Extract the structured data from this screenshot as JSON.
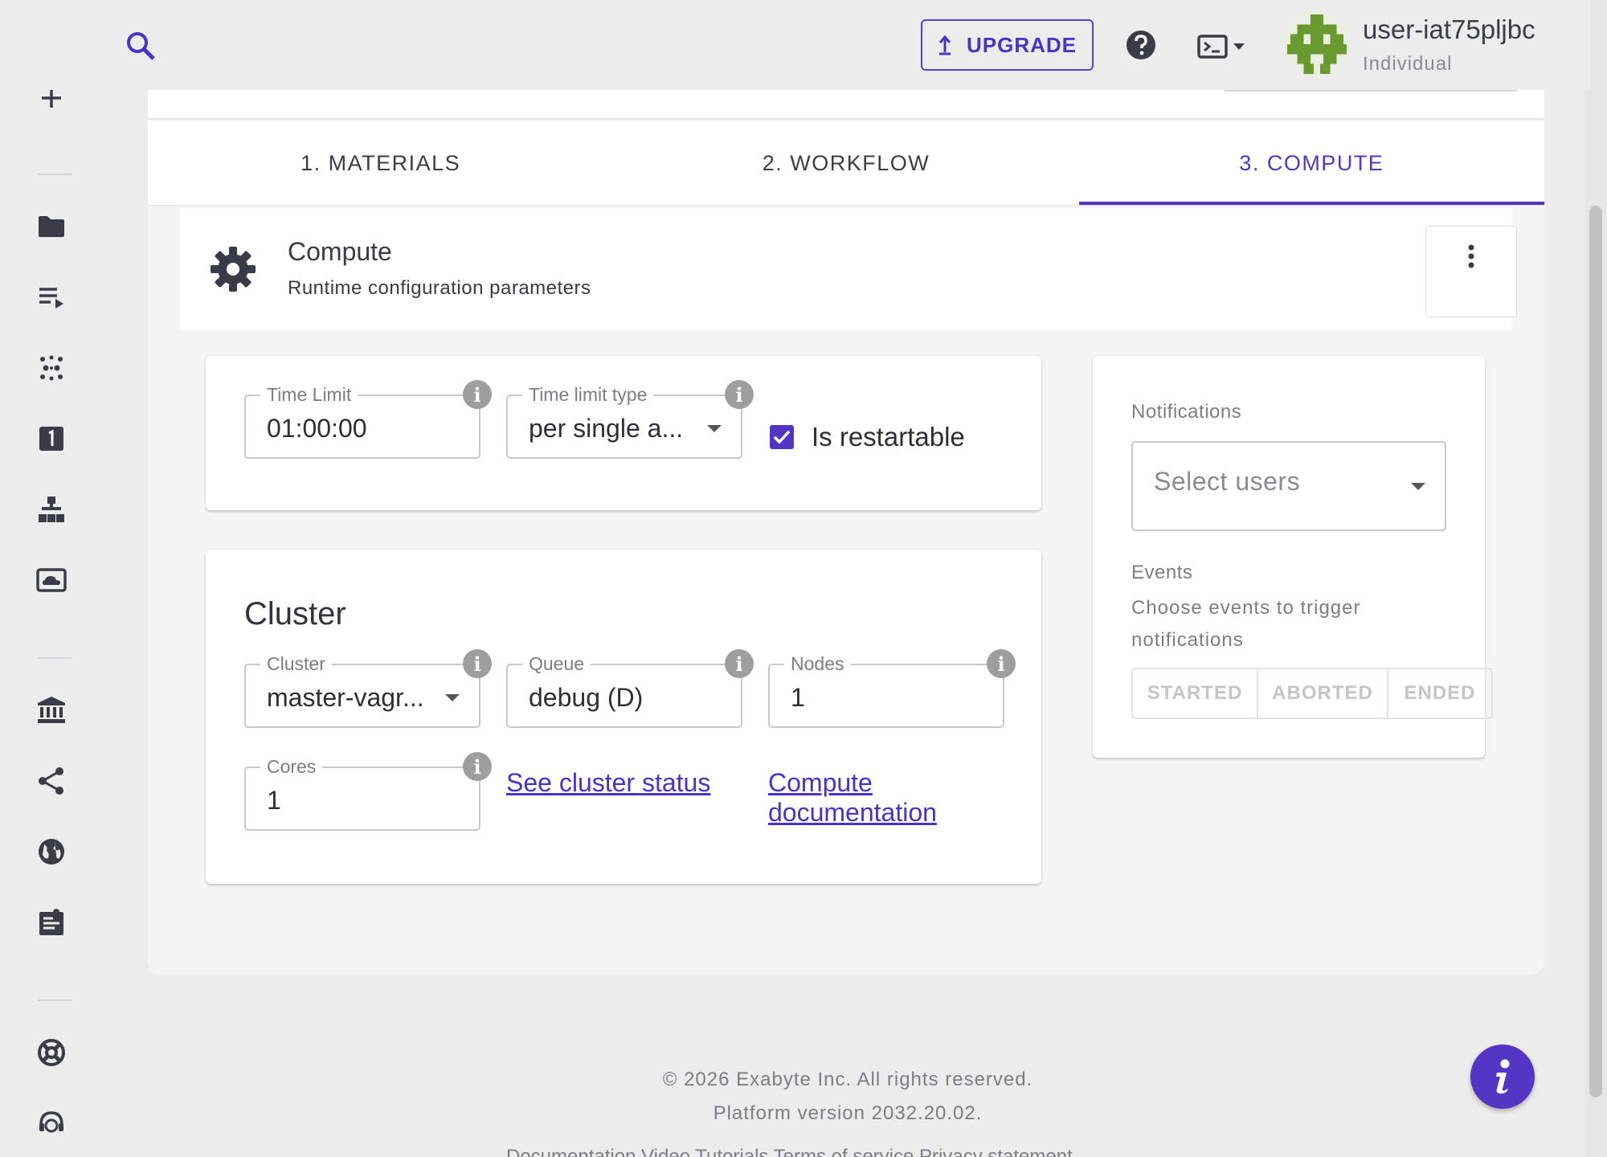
{
  "topbar": {
    "upgrade_label": "UPGRADE",
    "username": "user-iat75pljbc",
    "user_type": "Individual"
  },
  "sidebar": {
    "icons": [
      "logo-icon",
      "plus-icon",
      "folder-icon",
      "playlist-icon",
      "dots-grid-icon",
      "one-icon",
      "sitemap-icon",
      "cloud-screen-icon",
      "bank-icon",
      "share-icon",
      "globe-icon",
      "notes-icon",
      "lifebuoy-icon",
      "support-agent-icon"
    ]
  },
  "tabs": [
    {
      "label": "1. MATERIALS",
      "active": false
    },
    {
      "label": "2. WORKFLOW",
      "active": false
    },
    {
      "label": "3. COMPUTE",
      "active": true
    }
  ],
  "compute": {
    "title": "Compute",
    "subtitle": "Runtime configuration parameters"
  },
  "time_card": {
    "time_limit_label": "Time Limit",
    "time_limit_value": "01:00:00",
    "time_limit_type_label": "Time limit type",
    "time_limit_type_value": "per single a...",
    "is_restartable_label": "Is restartable",
    "is_restartable_checked": true
  },
  "cluster_card": {
    "title": "Cluster",
    "cluster_label": "Cluster",
    "cluster_value": "master-vagr...",
    "queue_label": "Queue",
    "queue_value": "debug (D)",
    "nodes_label": "Nodes",
    "nodes_value": "1",
    "cores_label": "Cores",
    "cores_value": "1",
    "cluster_status_link": "See cluster status",
    "compute_doc_link_line1": "Compute",
    "compute_doc_link_line2": "documentation"
  },
  "notifications": {
    "label": "Notifications",
    "select_placeholder": "Select users",
    "events_label": "Events",
    "events_desc": "Choose events to trigger notifications",
    "event_buttons": [
      "STARTED",
      "ABORTED",
      "ENDED"
    ]
  },
  "footer": {
    "copyright": "© 2026 Exabyte Inc. All rights reserved.",
    "version": "Platform version 2032.20.02.",
    "links": "Documentation   Video Tutorials   Terms of service   Privacy statement"
  },
  "colors": {
    "accent": "#5336c4",
    "background": "#ececec",
    "card": "#ffffff"
  }
}
